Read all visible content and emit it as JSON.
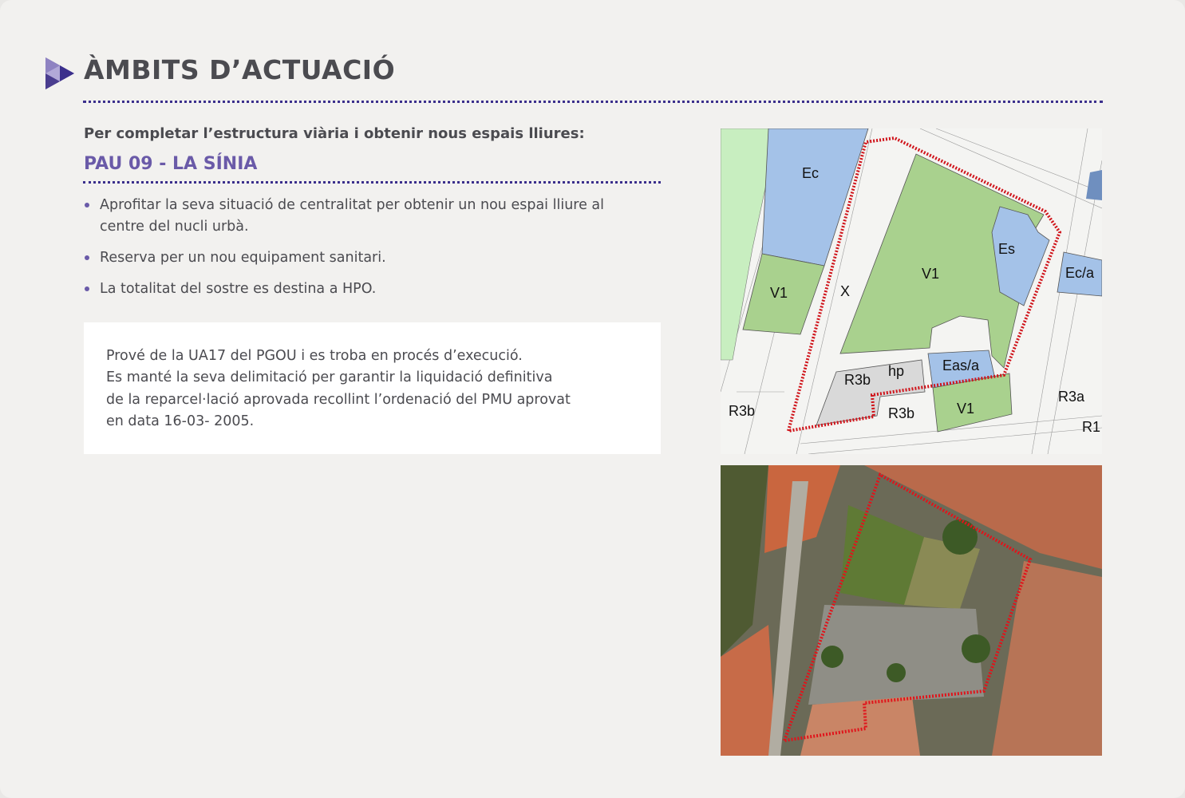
{
  "header": {
    "title": "ÀMBITS D’ACTUACIÓ",
    "accent_color": "#6a5aa8",
    "rule_color": "#3b2f8c"
  },
  "intro": "Per completar l’estructura viària i obtenir nous espais lliures:",
  "section_title": "PAU 09 - LA SÍNIA",
  "bullets": [
    "Aprofitar la seva situació de centralitat per obtenir un nou espai lliure al centre del nucli urbà.",
    "Reserva per un nou equipament sanitari.",
    "La totalitat del sostre es destina a HPO."
  ],
  "note": {
    "lines": [
      "Prové de la UA17 del PGOU i es troba en procés d’execució.",
      "Es manté la seva delimitació per garantir la liquidació definitiva",
      "de la reparcel·lació aprovada recollint l’ordenació del PMU aprovat",
      "en data 16-03- 2005."
    ]
  },
  "map": {
    "zone_labels": {
      "ec": "Ec",
      "v1_left": "V1",
      "x": "X",
      "v1_center": "V1",
      "es": "Es",
      "eca": "Ec/a",
      "easa": "Eas/a",
      "hp": "hp",
      "r3b_1": "R3b",
      "r3b_2": "R3b",
      "r3b_3": "R3b",
      "v1_bottom": "V1",
      "r3a": "R3a",
      "r1": "R1"
    },
    "colors": {
      "green": "#a9d18e",
      "blue": "#a4c2e8",
      "gray": "#d9d9d9",
      "boundary": "#d0141b"
    }
  },
  "aerial_photo": {
    "boundary_color": "#e0141b"
  }
}
